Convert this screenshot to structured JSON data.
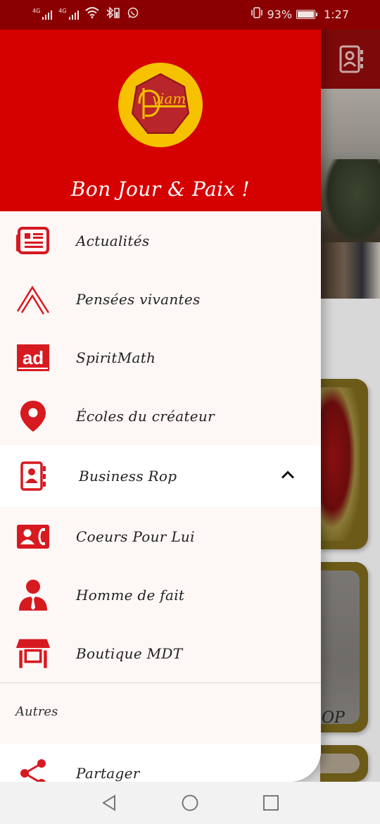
{
  "status_bar": {
    "net1": "4G",
    "net2": "4G",
    "battery_pct": "93%",
    "time": "1:27"
  },
  "header": {
    "logo_text": "yiam",
    "greeting": "Bon Jour & Paix !"
  },
  "menu": {
    "items": [
      {
        "label": "Actualités",
        "icon": "newspaper-icon"
      },
      {
        "label": "Pensées vivantes",
        "icon": "mountain-peak-icon"
      },
      {
        "label": "SpiritMath",
        "icon": "ad-badge-icon"
      },
      {
        "label": "Écoles du créateur",
        "icon": "location-pin-icon"
      }
    ],
    "section": {
      "label": "Business Rop",
      "icon": "contact-book-icon",
      "expanded": true
    },
    "sub_items": [
      {
        "label": "Coeurs Pour Lui",
        "icon": "contact-phone-icon"
      },
      {
        "label": "Homme de fait",
        "icon": "businessman-icon"
      },
      {
        "label": "Boutique MDT",
        "icon": "store-icon"
      }
    ],
    "other_title": "Autres",
    "other_items": [
      {
        "label": "Partager",
        "icon": "share-icon"
      }
    ]
  },
  "background": {
    "card_tag": "OP"
  },
  "colors": {
    "primary": "#d50000",
    "status_bar": "#8a0000",
    "logo_yellow": "#f6c200",
    "icon_red": "#d71920"
  }
}
